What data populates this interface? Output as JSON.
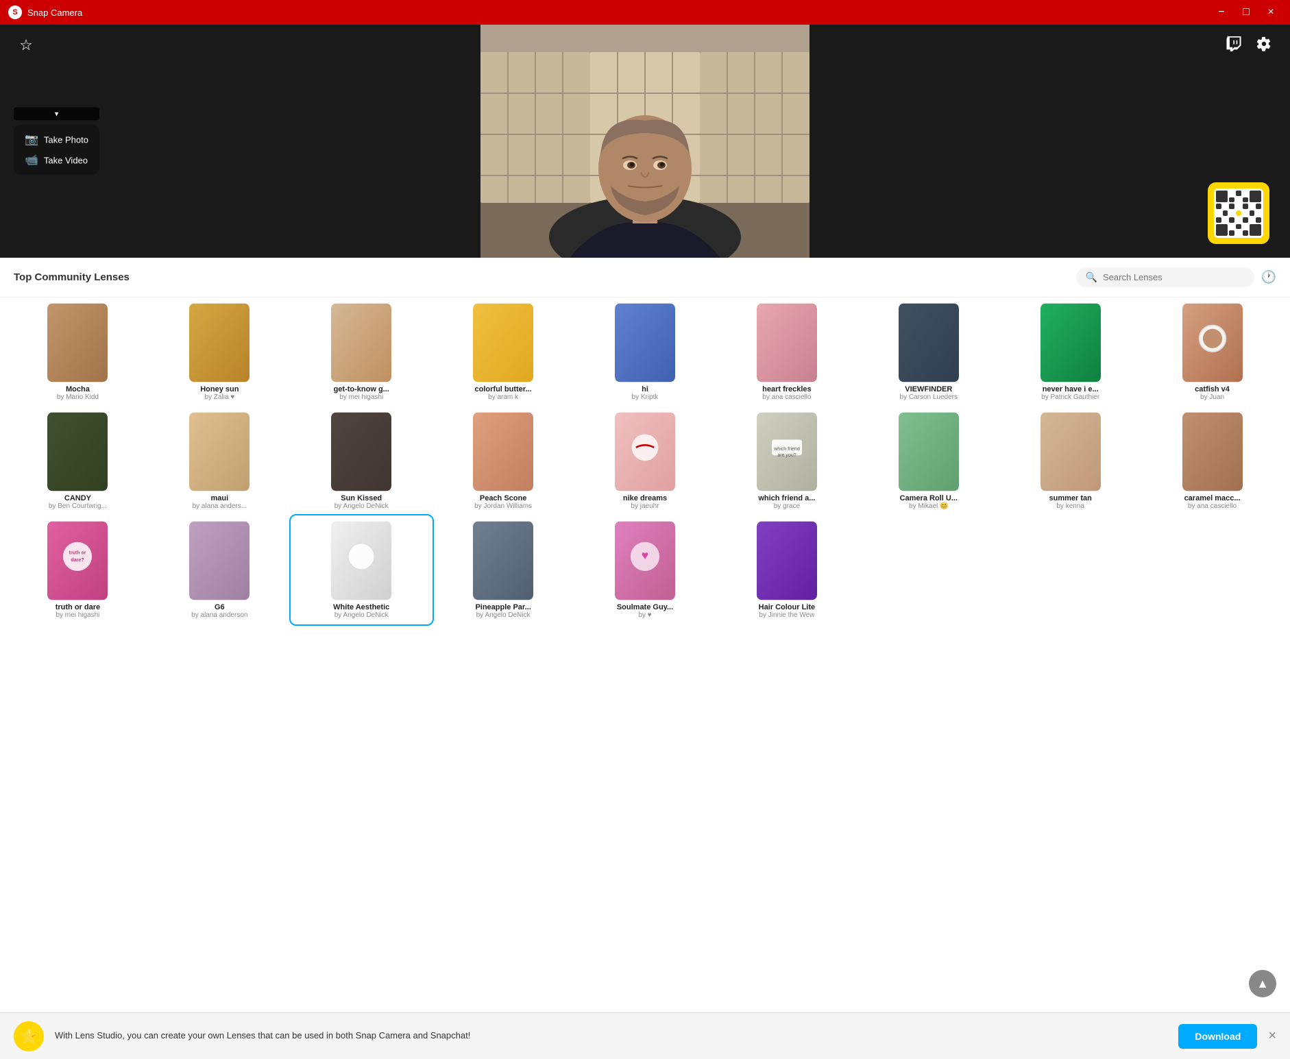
{
  "app": {
    "title": "Snap Camera",
    "logo": "S"
  },
  "titlebar": {
    "minimize_label": "−",
    "maximize_label": "□",
    "close_label": "×"
  },
  "camera": {
    "star_icon": "☆",
    "twitch_icon": "T",
    "settings_icon": "⚙",
    "dropdown_icon": "▾",
    "take_photo": "Take Photo",
    "take_video": "Take Video",
    "photo_icon": "📷",
    "video_icon": "🎬"
  },
  "lenses": {
    "section_title": "Top Community Lenses",
    "search_placeholder": "Search Lenses",
    "rows": [
      [
        {
          "name": "Mocha",
          "author": "by Mario Kidd",
          "thumb": "mocha"
        },
        {
          "name": "Honey sun",
          "author": "by Zalia ♥",
          "thumb": "honeysun"
        },
        {
          "name": "get-to-know g...",
          "author": "by mei higashi",
          "thumb": "gettoknow"
        },
        {
          "name": "colorful butter...",
          "author": "by aram k",
          "thumb": "colorbutter"
        },
        {
          "name": "hi",
          "author": "by Kriptk",
          "thumb": "hi"
        },
        {
          "name": "heart freckles",
          "author": "by ana casciello",
          "thumb": "heartfreckles"
        },
        {
          "name": "VIEWFINDER",
          "author": "by Carson Lueders",
          "thumb": "viewfinder"
        },
        {
          "name": "never have i e...",
          "author": "by Patrick Gauthier",
          "thumb": "neverhave"
        }
      ],
      [
        {
          "name": "catfish v4",
          "author": "by Juan",
          "thumb": "catfish"
        },
        {
          "name": "CANDY",
          "author": "by Ben Courtwrig...",
          "thumb": "candy"
        },
        {
          "name": "maui",
          "author": "by alana anders...",
          "thumb": "maui"
        },
        {
          "name": "Sun Kissed",
          "author": "by Angelo DeNick",
          "thumb": "sunkissed"
        },
        {
          "name": "Peach Scone",
          "author": "by Jordan Williams",
          "thumb": "peachscone"
        },
        {
          "name": "nike dreams",
          "author": "by jaeuhr",
          "thumb": "nikedreams"
        },
        {
          "name": "which friend a...",
          "author": "by grace",
          "thumb": "whichfriend"
        },
        {
          "name": "Camera Roll U...",
          "author": "by Mikael 😊",
          "thumb": "cameraroll"
        }
      ],
      [
        {
          "name": "summer tan",
          "author": "by kenna",
          "thumb": "summertan"
        },
        {
          "name": "caramel macc...",
          "author": "by ana casciello",
          "thumb": "caramelmac"
        },
        {
          "name": "truth or dare",
          "author": "by mei higashi",
          "thumb": "truthordare"
        },
        {
          "name": "G6",
          "author": "by alana anderson",
          "thumb": "g6"
        },
        {
          "name": "White Aesthetic",
          "author": "by Angelo DeNick",
          "thumb": "whiteaes",
          "selected": true
        },
        {
          "name": "Pineapple Par...",
          "author": "by Angelo DeNick",
          "thumb": "pineapple"
        },
        {
          "name": "Soulmate Guy...",
          "author": "by ♥",
          "thumb": "soulmate"
        },
        {
          "name": "Hair Colour Lite",
          "author": "by Jinnie the Wew",
          "thumb": "haircolour"
        }
      ],
      [
        {
          "name": "...",
          "author": "...",
          "thumb": "row4a"
        },
        {
          "name": "...",
          "author": "...",
          "thumb": "row4b"
        },
        {
          "name": "...",
          "author": "...",
          "thumb": "row4c"
        },
        {
          "name": "...",
          "author": "...",
          "thumb": "row4d"
        },
        {
          "name": "...",
          "author": "...",
          "thumb": "row4e"
        },
        {
          "name": "...",
          "author": "...",
          "thumb": "row4f"
        },
        {
          "name": "...",
          "author": "...",
          "thumb": "row4g"
        },
        {
          "name": "...",
          "author": "...",
          "thumb": "row4h"
        }
      ]
    ]
  },
  "banner": {
    "icon": "⭐",
    "text": "With Lens Studio, you can create your own Lenses that can be used in both Snap Camera and Snapchat!",
    "download_label": "Download",
    "close_icon": "×"
  }
}
